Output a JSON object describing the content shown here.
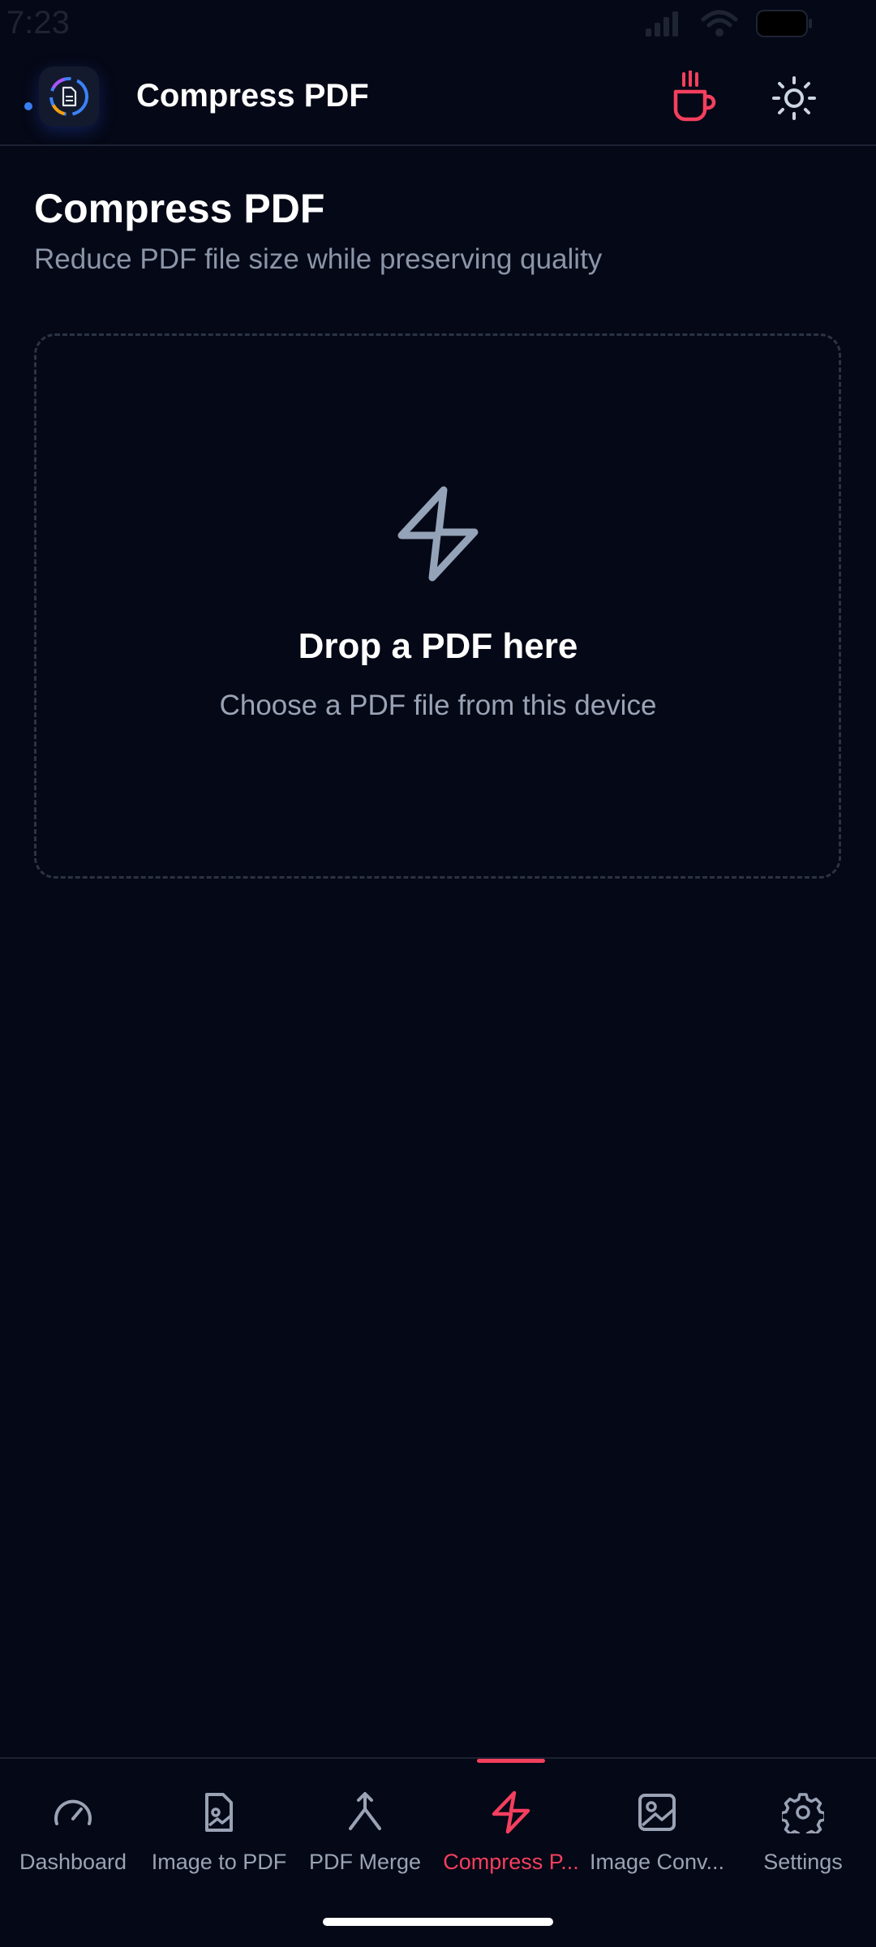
{
  "status_bar": {
    "time": "7:23",
    "signal_icon": "cellular-signal-icon",
    "wifi_icon": "wifi-icon",
    "battery_icon": "battery-icon"
  },
  "app_bar": {
    "title": "Compress PDF",
    "logo_icon": "app-logo-icon",
    "coffee_icon": "coffee-cup-icon",
    "theme_icon": "sun-icon",
    "accent_color": "#f43f5e"
  },
  "header": {
    "title": "Compress PDF",
    "subtitle": "Reduce PDF file size while preserving quality"
  },
  "drop_zone": {
    "icon": "lightning-bolt-icon",
    "title": "Drop a PDF here",
    "subtitle": "Choose a PDF file from this device"
  },
  "bottom_nav": {
    "active_index": 3,
    "items": [
      {
        "label": "Dashboard",
        "icon": "gauge-icon"
      },
      {
        "label": "Image to PDF",
        "icon": "image-file-icon"
      },
      {
        "label": "PDF Merge",
        "icon": "merge-icon"
      },
      {
        "label": "Compress P...",
        "icon": "lightning-bolt-icon"
      },
      {
        "label": "Image Conv...",
        "icon": "image-icon"
      },
      {
        "label": "Settings",
        "icon": "gear-icon"
      }
    ]
  },
  "colors": {
    "background": "#050816",
    "text_primary": "#ffffff",
    "text_secondary": "#9aa3b5",
    "accent": "#f43f5e",
    "border": "#2b3345"
  }
}
